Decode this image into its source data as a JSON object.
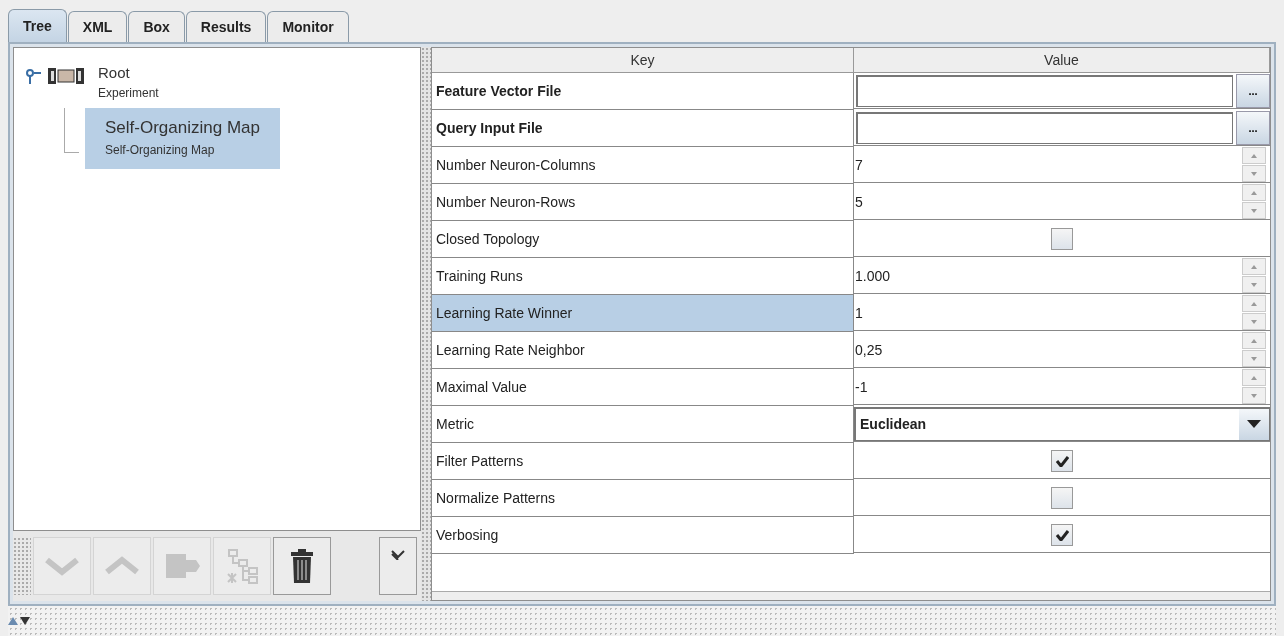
{
  "tabs": [
    {
      "label": "Tree",
      "selected": true
    },
    {
      "label": "XML",
      "selected": false
    },
    {
      "label": "Box",
      "selected": false
    },
    {
      "label": "Results",
      "selected": false
    },
    {
      "label": "Monitor",
      "selected": false
    }
  ],
  "tree": {
    "title": "Root",
    "subtitle": "Experiment",
    "expanded": true,
    "children": [
      {
        "title": "Self-Organizing Map",
        "subtitle": "Self-Organizing Map",
        "selected": true
      }
    ]
  },
  "toolbar": [
    {
      "kind": "down",
      "disabled": true
    },
    {
      "kind": "up",
      "disabled": true
    },
    {
      "kind": "module",
      "disabled": true
    },
    {
      "kind": "tree",
      "disabled": true
    },
    {
      "kind": "delete",
      "disabled": false
    }
  ],
  "table": {
    "columns": [
      "Key",
      "Value"
    ],
    "rows": [
      {
        "key": "Feature Vector File",
        "kind": "file",
        "bold": true,
        "selected": false,
        "value": "",
        "button": "..."
      },
      {
        "key": "Query Input File",
        "kind": "file",
        "bold": true,
        "selected": false,
        "value": "",
        "button": "..."
      },
      {
        "key": "Number Neuron-Columns",
        "kind": "spinner",
        "bold": false,
        "selected": false,
        "value": "7"
      },
      {
        "key": "Number Neuron-Rows",
        "kind": "spinner",
        "bold": false,
        "selected": false,
        "value": "5"
      },
      {
        "key": "Closed Topology",
        "kind": "checkbox",
        "bold": false,
        "selected": false,
        "checked": false
      },
      {
        "key": "Training Runs",
        "kind": "spinner",
        "bold": false,
        "selected": false,
        "value": "1.000"
      },
      {
        "key": "Learning Rate Winner",
        "kind": "spinner",
        "bold": false,
        "selected": true,
        "value": "1"
      },
      {
        "key": "Learning Rate Neighbor",
        "kind": "spinner",
        "bold": false,
        "selected": false,
        "value": "0,25"
      },
      {
        "key": "Maximal Value",
        "kind": "spinner",
        "bold": false,
        "selected": false,
        "value": "-1"
      },
      {
        "key": "Metric",
        "kind": "combo",
        "bold": false,
        "selected": false,
        "value": "Euclidean"
      },
      {
        "key": "Filter Patterns",
        "kind": "checkbox",
        "bold": false,
        "selected": false,
        "checked": true
      },
      {
        "key": "Normalize Patterns",
        "kind": "checkbox",
        "bold": false,
        "selected": false,
        "checked": false
      },
      {
        "key": "Verbosing",
        "kind": "checkbox",
        "bold": false,
        "selected": false,
        "checked": true
      }
    ]
  }
}
